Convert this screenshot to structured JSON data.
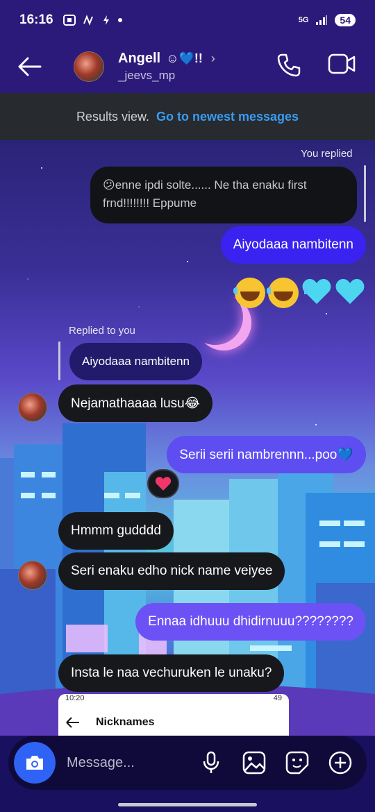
{
  "status": {
    "time": "16:16",
    "network": "5G",
    "battery": "54"
  },
  "header": {
    "name": "Angell",
    "name_emojis": "☺💙!!",
    "username": "_jeevs_mp"
  },
  "results": {
    "label": "Results view.",
    "link": "Go to newest messages"
  },
  "messages": {
    "you_replied": "You replied",
    "quoted_text": "😕enne ipdi solte...... Ne tha enaku first frnd!!!!!!!! Eppume",
    "m1": "Aiyodaaa nambitenn",
    "replied_to_you": "Replied to you",
    "m2_quote": "Aiyodaaa nambitenn",
    "m3": "Nejamathaaaa lusu😂",
    "m4": "Serii serii nambrennn...poo💙",
    "m5": "Hmmm gudddd",
    "m6": "Seri enaku edho nick name veiyee",
    "m7": "Ennaa idhuuu dhidirnuuu????????",
    "m8": "Insta le naa vechuruken le unaku?"
  },
  "shared_screenshot": {
    "time": "10:20",
    "battery": "49",
    "title": "Nicknames"
  },
  "composer": {
    "placeholder": "Message..."
  },
  "colors": {
    "accent": "#2f63f5",
    "link": "#3a9bf0",
    "header_bg": "#2b1a7a"
  }
}
